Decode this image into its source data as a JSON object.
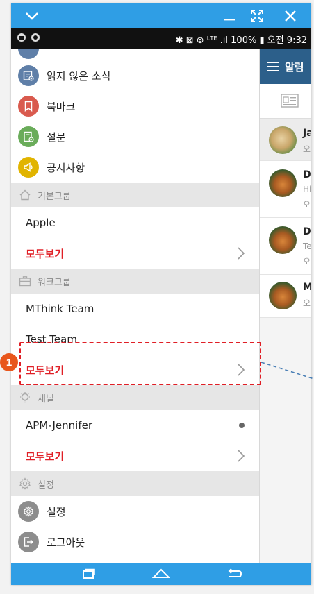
{
  "statusbar": {
    "right_text": "✱ ⊠ ⊚ ᴸᵀᴱ .ıl 100% ▮ 오전 9:32"
  },
  "behind": {
    "header_title": "알림",
    "chats": [
      {
        "name": "Ja",
        "preview": "오"
      },
      {
        "name": "D",
        "preview": "Hi",
        "preview2": "오"
      },
      {
        "name": "D",
        "preview": "Te",
        "preview2": "오"
      },
      {
        "name": "M",
        "preview": "오"
      }
    ]
  },
  "drawer": {
    "menu": [
      {
        "label": "읽지 않은 소식",
        "icon": "unread-news-icon",
        "color": "#5f7fa8"
      },
      {
        "label": "북마크",
        "icon": "bookmark-icon",
        "color": "#d95a4e"
      },
      {
        "label": "설문",
        "icon": "survey-icon",
        "color": "#6aac5a"
      },
      {
        "label": "공지사항",
        "icon": "notice-icon",
        "color": "#e1b400"
      }
    ],
    "sections": {
      "basic_group": "기본그룹",
      "work_group": "워크그룹",
      "channel": "채널",
      "settings": "설정"
    },
    "basic_items": [
      "Apple"
    ],
    "work_items": [
      "MThink Team",
      "Test Team"
    ],
    "channel_items": [
      "APM-Jennifer"
    ],
    "view_all": "모두보기",
    "settings_items": [
      {
        "label": "설정",
        "icon": "settings-icon"
      },
      {
        "label": "로그아웃",
        "icon": "logout-icon"
      }
    ]
  },
  "annotation": {
    "badge": "1"
  },
  "colors": {
    "accent": "#2f9ee5",
    "header": "#2c5f8a",
    "view_all": "#e01f26",
    "callout": "#e01f26",
    "badge": "#e8561c"
  }
}
